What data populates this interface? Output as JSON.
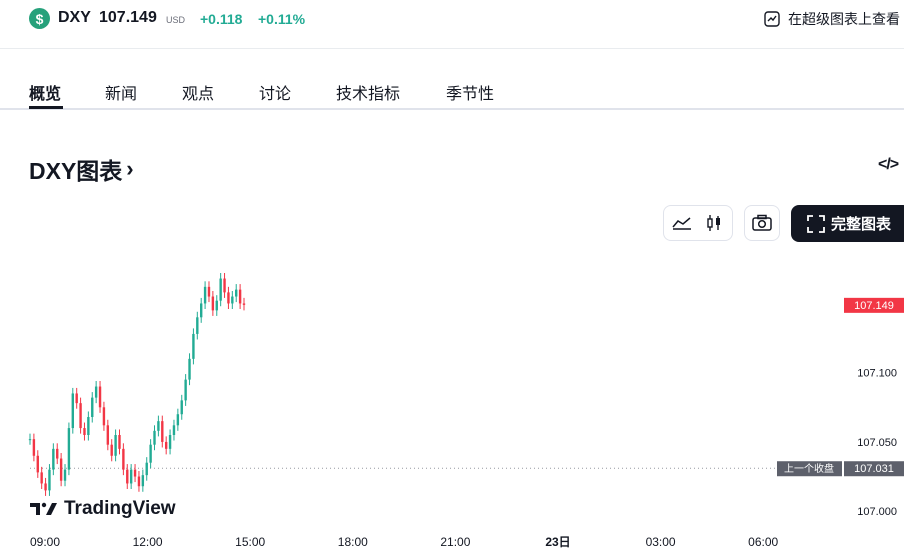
{
  "ticker": {
    "symbol": "DXY",
    "price": "107.149",
    "currency": "USD",
    "change": "+0.118",
    "change_pct": "+0.11%",
    "badge_glyph": "$",
    "super_chart_link": "在超级图表上查看"
  },
  "tabs": [
    {
      "label": "概览",
      "active": true
    },
    {
      "label": "新闻"
    },
    {
      "label": "观点"
    },
    {
      "label": "讨论"
    },
    {
      "label": "技术指标"
    },
    {
      "label": "季节性"
    }
  ],
  "section": {
    "title": "DXY图表",
    "chevron": "›",
    "embed_glyph": "</>"
  },
  "controls": {
    "full_chart_label": "完整图表",
    "icons": [
      "area-chart-icon",
      "candles-icon",
      "camera-icon",
      "fullscreen-icon"
    ]
  },
  "colors": {
    "up": "#22ab94",
    "down": "#f23645",
    "accent_green": "#26a17b",
    "dark": "#131722"
  },
  "chart_data": {
    "type": "line",
    "x_ticks": [
      "09:00",
      "12:00",
      "15:00",
      "18:00",
      "21:00",
      "23日",
      "03:00",
      "06:00"
    ],
    "y_ticks": [
      "107.100",
      "107.050",
      "107.000"
    ],
    "ylim": [
      106.99,
      107.185
    ],
    "current_price_label": "107.149",
    "prev_close_label": "上一个收盘",
    "prev_close_value": "107.031",
    "watermark": "TradingView",
    "series": [
      {
        "values": [
          107.052,
          107.04,
          107.028,
          107.02,
          107.015,
          107.03,
          107.045,
          107.038,
          107.022,
          107.03,
          107.06,
          107.085,
          107.078,
          107.06,
          107.055,
          107.068,
          107.082,
          107.09,
          107.075,
          107.062,
          107.048,
          107.04,
          107.055,
          107.045,
          107.03,
          107.02,
          107.03,
          107.025,
          107.018,
          107.026,
          107.035,
          107.048,
          107.058,
          107.065,
          107.05,
          107.045,
          107.055,
          107.062,
          107.07,
          107.08,
          107.095,
          107.11,
          107.128,
          107.14,
          107.15,
          107.162,
          107.155,
          107.145,
          107.152,
          107.168,
          107.158,
          107.15,
          107.155,
          107.16,
          107.15,
          107.149
        ]
      }
    ]
  }
}
